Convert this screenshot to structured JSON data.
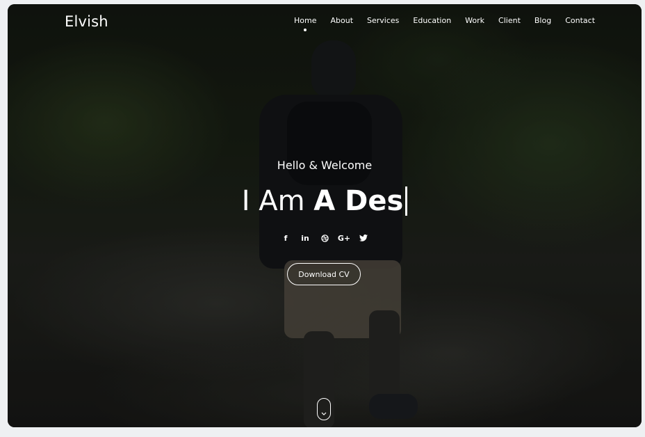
{
  "brand": {
    "name": "Elvish"
  },
  "nav": {
    "items": [
      {
        "label": "Home",
        "active": true
      },
      {
        "label": "About",
        "active": false
      },
      {
        "label": "Services",
        "active": false
      },
      {
        "label": "Education",
        "active": false
      },
      {
        "label": "Work",
        "active": false
      },
      {
        "label": "Client",
        "active": false
      },
      {
        "label": "Blog",
        "active": false
      },
      {
        "label": "Contact",
        "active": false
      }
    ]
  },
  "hero": {
    "greeting": "Hello & Welcome",
    "headline_light": "I Am ",
    "headline_bold": "A Des",
    "socials": [
      {
        "icon": "facebook-icon",
        "glyph": "f"
      },
      {
        "icon": "linkedin-icon",
        "glyph": "in"
      },
      {
        "icon": "dribbble-icon",
        "glyph": ""
      },
      {
        "icon": "google-plus-icon",
        "glyph": "G+"
      },
      {
        "icon": "twitter-icon",
        "glyph": ""
      }
    ],
    "cta_label": "Download CV",
    "scroll_icon": "chevron-down-icon"
  },
  "colors": {
    "text": "#ffffff",
    "overlay": "#0d100c"
  }
}
